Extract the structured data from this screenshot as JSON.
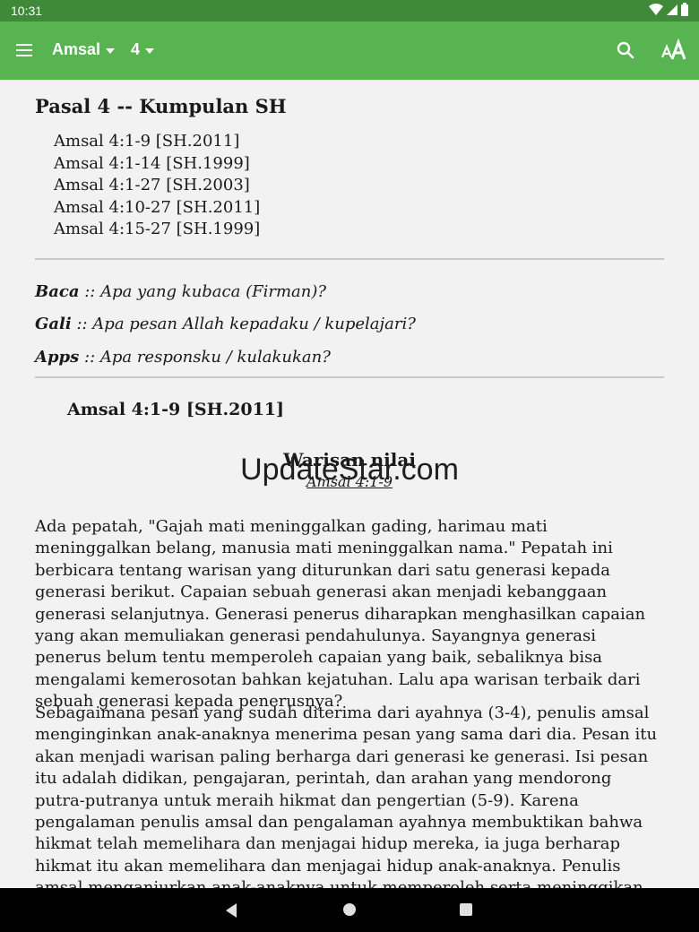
{
  "status_bar": {
    "time": "10:31",
    "icons": [
      "wifi-icon",
      "signal-icon",
      "battery-icon"
    ]
  },
  "app_bar": {
    "book": "Amsal",
    "chapter": "4",
    "icons": [
      "menu-icon",
      "chevron-down-icon",
      "search-icon",
      "text-size-icon"
    ],
    "color": "#58b351",
    "status_color": "#3f8a38"
  },
  "content": {
    "pasal_heading": "Pasal 4 -- Kumpulan SH",
    "refs": [
      "Amsal 4:1-9 [SH.2011]",
      "Amsal 4:1-14 [SH.1999]",
      "Amsal 4:1-27 [SH.2003]",
      "Amsal 4:10-27 [SH.2011]",
      "Amsal 4:15-27 [SH.1999]"
    ],
    "bga": [
      {
        "term": "Baca",
        "text": " :: Apa yang kubaca (Firman)?"
      },
      {
        "term": "Gali",
        "text": " :: Apa pesan Allah kepadaku / kupelajari?"
      },
      {
        "term": "Apps",
        "text": " :: Apa responsku / kulakukan?"
      }
    ],
    "section_ref": "Amsal 4:1-9  [SH.2011]",
    "section_title": "Warisan nilai",
    "section_link": "Amsal 4:1-9",
    "watermark": "UpdateStar.com",
    "paragraphs": [
      "Ada pepatah, \"Gajah mati meninggalkan gading, harimau mati meninggalkan belang, manusia mati meninggalkan nama.\" Pepatah ini berbicara tentang warisan yang diturunkan dari satu generasi kepada generasi berikut. Capaian sebuah generasi akan menjadi kebanggaan generasi selanjutnya. Generasi penerus diharapkan menghasilkan capaian yang akan memuliakan generasi pendahulunya. Sayangnya generasi penerus belum tentu memperoleh capaian yang baik, sebaliknya bisa mengalami kemerosotan bahkan kejatuhan. Lalu apa warisan terbaik dari sebuah generasi kepada penerusnya?",
      "Sebagaimana pesan yang sudah diterima dari ayahnya (3-4), penulis amsal menginginkan anak-anaknya menerima pesan yang sama dari dia. Pesan itu akan menjadi warisan paling berharga dari generasi ke generasi. Isi pesan itu adalah didikan, pengajaran, perintah, dan arahan yang mendorong putra-putranya untuk meraih hikmat dan pengertian (5-9). Karena pengalaman penulis amsal dan pengalaman ayahnya membuktikan bahwa hikmat telah memelihara dan menjagai hidup mereka, ia juga berharap hikmat itu akan memelihara dan menjagai hidup anak-anaknya. Penulis amsal menganjurkan anak-anaknya untuk memperoleh serta meninggikan hikmat dan pengertian"
    ]
  },
  "nav_bar": {
    "icons": [
      "back-icon",
      "home-icon",
      "recents-icon"
    ]
  }
}
